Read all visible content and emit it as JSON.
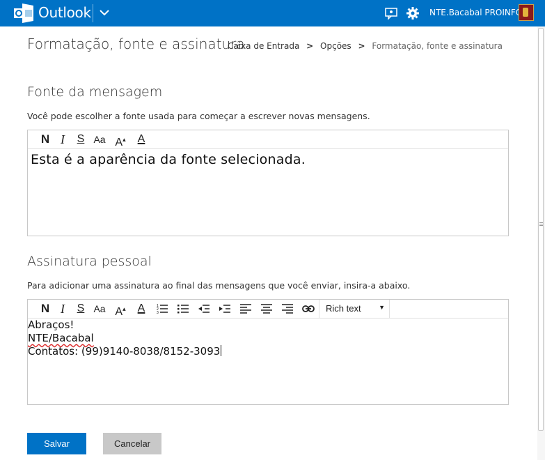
{
  "header": {
    "brand": "Outlook",
    "username": "NTE.Bacabal PROINFO"
  },
  "page": {
    "title": "Formatação, fonte e assinatura",
    "breadcrumb": [
      "Caixa de Entrada",
      "Opções",
      "Formatação, fonte e assinatura"
    ],
    "breadcrumb_sep": ">"
  },
  "font_section": {
    "title": "Fonte da mensagem",
    "description": "Você pode escolher a fonte usada para começar a escrever novas mensagens.",
    "preview": "Esta é a aparência da fonte selecionada."
  },
  "signature_section": {
    "title": "Assinatura pessoal",
    "description": "Para adicionar uma assinatura ao final das mensagens que você enviar, insira-a abaixo.",
    "format_select": "Rich text",
    "lines": [
      "Abraços!",
      "NTE/Bacabal",
      "Contatos: (99)9140-8038/8152-3093"
    ]
  },
  "toolbar": {
    "bold": "N",
    "italic": "I",
    "underline": "S",
    "font_size": "Aa",
    "grow": "A",
    "color": "A"
  },
  "buttons": {
    "save": "Salvar",
    "cancel": "Cancelar"
  },
  "colors": {
    "accent": "#0072c6",
    "cancel_bg": "#c8c8c8"
  }
}
